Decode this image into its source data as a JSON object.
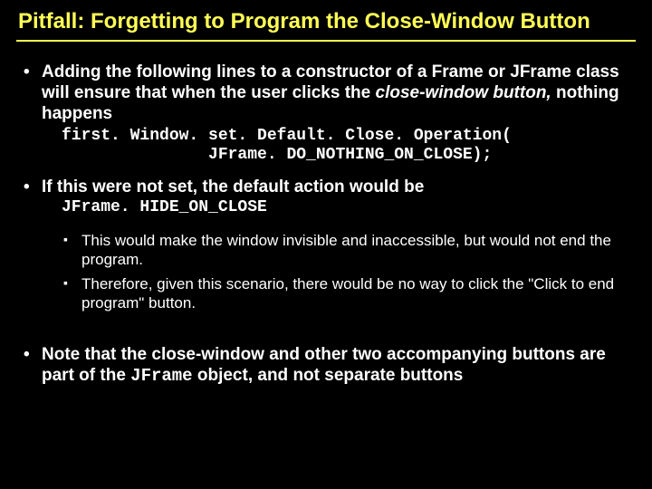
{
  "title": "Pitfall:  Forgetting to Program the Close-Window Button",
  "bullets": {
    "b1_a": "Adding the following lines to a constructor of a Frame or JFrame class will ensure that when the user clicks the ",
    "b1_b": "close-window button,",
    "b1_c": " nothing happens",
    "code1": "first. Window. set. Default. Close. Operation(\n               JFrame. DO_NOTHING_ON_CLOSE);",
    "b2_a": "If this were not set, the default action would be",
    "code2": "JFrame. HIDE_ON_CLOSE",
    "sub1": "This would make the window invisible and inaccessible, but would not end the program.",
    "sub2": "Therefore, given this scenario, there would be no way to click the \"Click to end program\" button.",
    "b3_a": "Note that the close-window and other two accompanying buttons are part of the ",
    "b3_code": "JFrame",
    "b3_b": " object, and not separate buttons"
  }
}
